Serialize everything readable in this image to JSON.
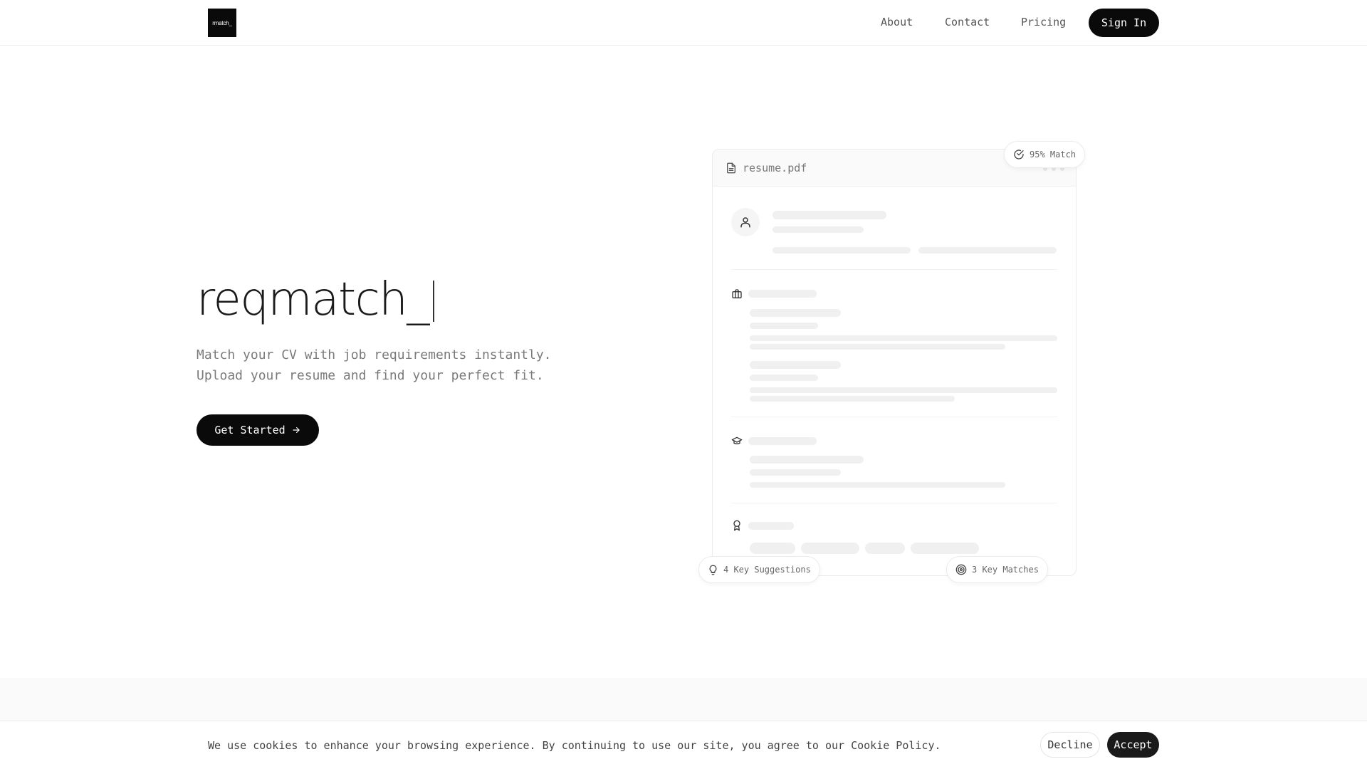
{
  "nav": {
    "logo_text": "rmatch_",
    "links": [
      "About",
      "Contact",
      "Pricing"
    ],
    "signin_label": "Sign In"
  },
  "hero": {
    "title": "reqmatch_",
    "subtitle_line1": "Match your CV with job requirements instantly.",
    "subtitle_line2": "Upload your resume and find your perfect fit.",
    "cta_label": "Get Started",
    "cta_icon": "arrow-right-icon"
  },
  "preview": {
    "filename": "resume.pdf",
    "file_icon": "file-text-icon",
    "match_badge": "95% Match",
    "match_icon": "check-circle-icon",
    "suggestions_badge": "4 Key Suggestions",
    "suggestions_icon": "lightbulb-icon",
    "matches_badge": "3 Key Matches",
    "matches_icon": "target-icon",
    "section_icons": [
      "user-icon",
      "briefcase-icon",
      "graduation-cap-icon",
      "award-icon"
    ]
  },
  "cookie": {
    "message": "We use cookies to enhance your browsing experience. By continuing to use our site, you agree to our Cookie Policy.",
    "decline_label": "Decline",
    "accept_label": "Accept"
  },
  "colors": {
    "primary": "#0a0a0a",
    "muted_text": "#7a7a7a",
    "skeleton": "#f0f0f0",
    "border": "#ececec"
  }
}
